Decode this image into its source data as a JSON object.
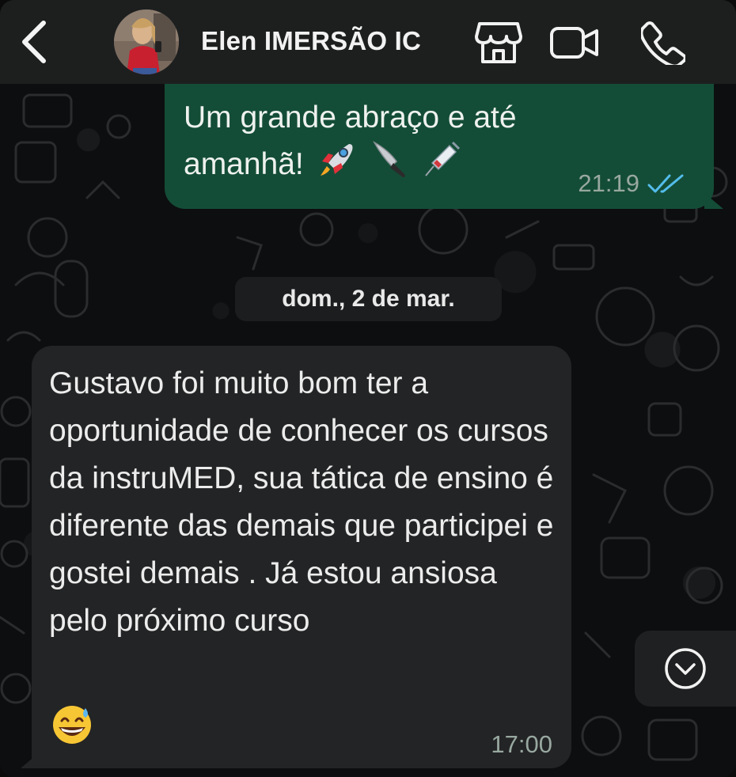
{
  "header": {
    "back_icon": "chevron-left-icon",
    "contact_name": "Elen IMERSÃO IC",
    "store_icon": "storefront-icon",
    "video_icon": "video-camera-icon",
    "call_icon": "phone-icon"
  },
  "messages": {
    "outgoing": {
      "line1": "Um grande abraço e até",
      "line2": "amanhã!",
      "emojis": [
        "rocket-emoji",
        "knife-emoji",
        "syringe-emoji"
      ],
      "time": "21:19",
      "status": "read",
      "status_color": "#53bdeb"
    },
    "date_separator": "dom., 2 de mar.",
    "incoming": {
      "text": "Gustavo foi muito bom ter a oportunidade de conhecer os cursos da instruMED, sua tática de ensino é diferente das demais que participei e gostei demais . Já estou ansiosa pelo próximo curso",
      "emoji": "grinning-sweat-emoji",
      "time": "17:00"
    }
  },
  "scroll_button": {
    "icon": "chevron-down-circle-icon"
  },
  "colors": {
    "outgoing_bubble": "#144d37",
    "incoming_bubble": "#232425",
    "header_bg": "#1d1f1f",
    "read_ticks": "#53bdeb"
  }
}
